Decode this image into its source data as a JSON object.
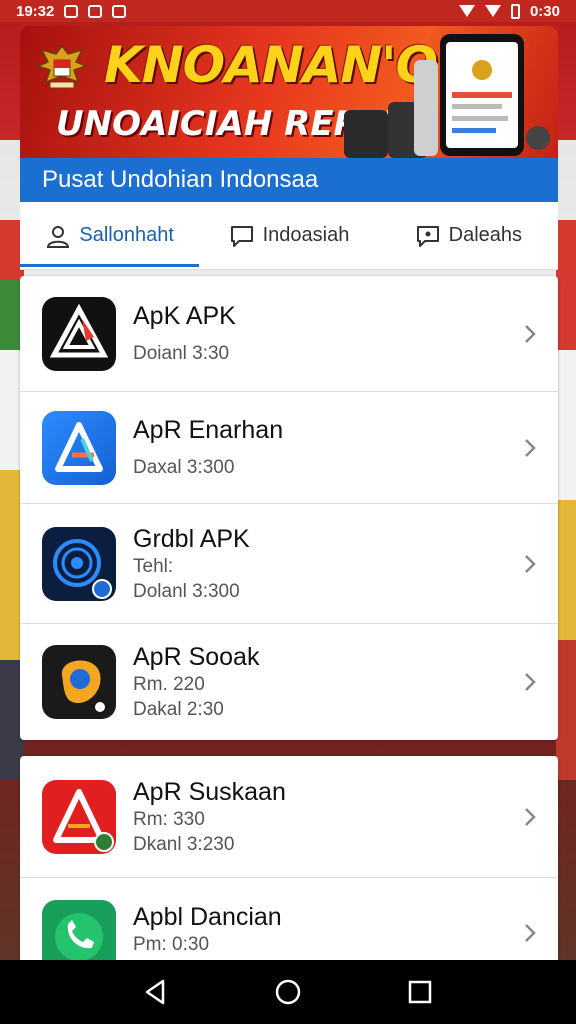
{
  "status_bar": {
    "time_left": "19:32",
    "time_right": "0:30"
  },
  "banner": {
    "title": "KNOANAN'O",
    "subtitle": "UNOAICIAH REPAN"
  },
  "header": {
    "title": "Pusat Undohian Indonsaa"
  },
  "tabs": [
    {
      "label": "Sallonhaht",
      "icon": "person-icon",
      "active": true
    },
    {
      "label": "Indoasiah",
      "icon": "chat-icon",
      "active": false
    },
    {
      "label": "Daleahs",
      "icon": "message-icon",
      "active": false
    }
  ],
  "apps": [
    {
      "name": "ApK APK",
      "line1": "",
      "line2": "Doianl 3:30",
      "icon": "triangle-logo-icon"
    },
    {
      "name": "ApR Enarhan",
      "line1": "",
      "line2": "Daxal 3:300",
      "icon": "blue-a-logo-icon"
    },
    {
      "name": "Grdbl APK",
      "line1": "Tehl:",
      "line2": "Dolanl 3:300",
      "icon": "target-chat-icon"
    },
    {
      "name": "ApR Sooak",
      "line1": "Rm. 220",
      "line2": "Dakal 2:30",
      "icon": "orange-blob-icon"
    },
    {
      "name": "ApR Suskaan",
      "line1": "Rm: 330",
      "line2": "Dkanl 3:230",
      "icon": "red-a-logo-icon"
    },
    {
      "name": "Apbl Dancian",
      "line1": "Pm: 0:30",
      "line2": "",
      "icon": "phone-icon"
    }
  ],
  "colors": {
    "primary": "#1a6fd1",
    "banner_red": "#e7371f",
    "banner_yellow": "#ffd21a"
  }
}
